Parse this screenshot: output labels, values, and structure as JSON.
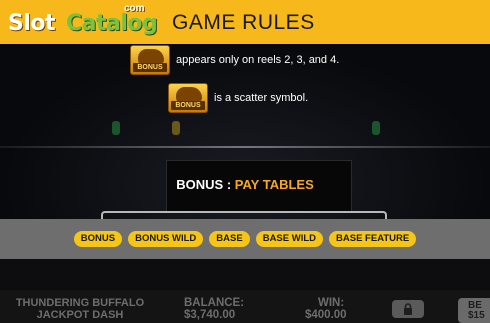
{
  "header": {
    "logo": {
      "part1": "Slot",
      "part2": "Catalog",
      "suffix": "com"
    },
    "title": "GAME RULES"
  },
  "rules": [
    {
      "icon": "bonus-buffalo-icon",
      "icon_label": "BONUS",
      "text": "appears only on reels 2, 3, and 4."
    },
    {
      "icon": "bonus-buffalo-icon",
      "icon_label": "BONUS",
      "text": "is a scatter symbol."
    }
  ],
  "section": {
    "prefix": "BONUS",
    "separator": " : ",
    "highlight": "PAY TABLES"
  },
  "tabs": [
    "BONUS",
    "BONUS WILD",
    "BASE",
    "BASE WILD",
    "BASE FEATURE"
  ],
  "footer": {
    "game_name_line1": "THUNDERING BUFFALO",
    "game_name_line2": "JACKPOT DASH",
    "balance_label": "BALANCE:",
    "balance_value": "$3,740.00",
    "win_label": "WIN:",
    "win_value": "$400.00",
    "bet_label": "BE",
    "bet_value": "$15"
  },
  "colors": {
    "header_bg": "#f6b81a",
    "accent": "#f6a821",
    "tab_bg": "#f5c518",
    "tabbar_bg": "#6e6e6e",
    "logo_green": "#7cc242"
  }
}
